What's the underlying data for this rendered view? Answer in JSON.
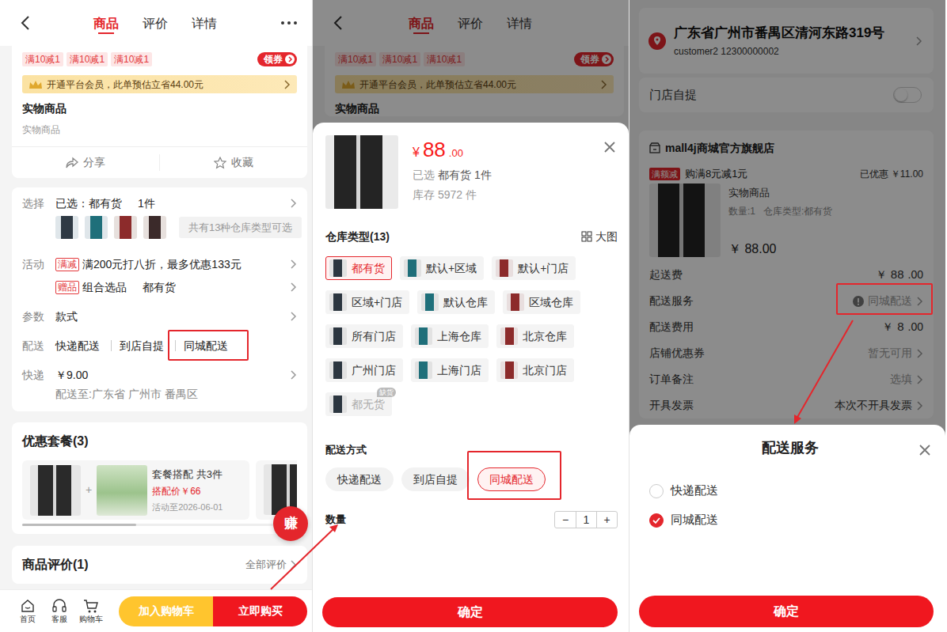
{
  "product_page": {
    "tabs": [
      {
        "label": "商品",
        "selected": true
      },
      {
        "label": "评价",
        "selected": false
      },
      {
        "label": "详情",
        "selected": false
      }
    ],
    "coupons": [
      "满10减1",
      "满10减1",
      "满10减1"
    ],
    "coupon_button": "领券",
    "member_banner": "开通平台会员，此单预估立省44.00元",
    "title": "实物商品",
    "subtitle": "实物商品",
    "actions": [
      "分享",
      "收藏"
    ],
    "select": {
      "label": "选择",
      "value": "已选：都有货",
      "quantity": "1件",
      "more": "共有13种仓库类型可选"
    },
    "activity": {
      "label": "活动",
      "items": [
        {
          "tag": "满减",
          "text": "满200元打八折，最多优惠133元"
        },
        {
          "tag": "赠品",
          "text": "组合选品",
          "extra": "都有货"
        }
      ]
    },
    "params": {
      "label": "参数",
      "value": "款式"
    },
    "delivery": {
      "label": "配送",
      "options": [
        {
          "label": "快递配送",
          "highlighted": false
        },
        {
          "label": "到店自提",
          "highlighted": false
        },
        {
          "label": "同城配送",
          "highlighted": true
        }
      ]
    },
    "express": {
      "label": "快递",
      "price": "￥9.00",
      "destination": "配送至:广东省 广州市 番禺区"
    },
    "packages": {
      "title": "优惠套餐(3)",
      "items": [
        {
          "name": "套餐搭配 共3件",
          "price": "搭配价￥66",
          "deadline": "活动至2026-06-01"
        }
      ],
      "scroll_level": 0.4
    },
    "earn_button": "赚",
    "reviews": {
      "title": "商品评价(1)",
      "more": "全部评价"
    },
    "bottom_nav": [
      "首页",
      "客服",
      "购物车"
    ],
    "add_to_cart": "加入购物车",
    "buy_now": "立即购买"
  },
  "sku_page": {
    "background": {
      "tabs": [
        {
          "label": "商品",
          "selected": true
        },
        {
          "label": "评价",
          "selected": false
        },
        {
          "label": "详情",
          "selected": false
        }
      ],
      "coupons": [
        "满10减1",
        "满10减1",
        "满10减1"
      ],
      "coupon_button": "领券",
      "member_banner": "开通平台会员，此单预估立省44.00元",
      "title": "实物商品"
    },
    "sheet": {
      "price": {
        "currency": "¥",
        "integer": "88",
        "decimal": ".00"
      },
      "selected_label": "已选",
      "selected_value": "都有货 1件",
      "stock": "库存 5972 件",
      "warehouse_title": "仓库类型(13)",
      "big_image": "大图",
      "warehouses": [
        {
          "label": "都有货",
          "selected": true,
          "disabled": false
        },
        {
          "label": "默认+区域",
          "selected": false,
          "disabled": false
        },
        {
          "label": "默认+门店",
          "selected": false,
          "disabled": false
        },
        {
          "label": "区域+门店",
          "selected": false,
          "disabled": false
        },
        {
          "label": "默认仓库",
          "selected": false,
          "disabled": false
        },
        {
          "label": "区域仓库",
          "selected": false,
          "disabled": false
        },
        {
          "label": "所有门店",
          "selected": false,
          "disabled": false
        },
        {
          "label": "上海仓库",
          "selected": false,
          "disabled": false
        },
        {
          "label": "北京仓库",
          "selected": false,
          "disabled": false
        },
        {
          "label": "广州门店",
          "selected": false,
          "disabled": false
        },
        {
          "label": "上海门店",
          "selected": false,
          "disabled": false
        },
        {
          "label": "北京门店",
          "selected": false,
          "disabled": false
        },
        {
          "label": "都无货",
          "selected": false,
          "disabled": true,
          "badge": "缺货"
        }
      ],
      "delivery_title": "配送方式",
      "delivery_options": [
        {
          "label": "快递配送",
          "selected": false,
          "highlighted": false
        },
        {
          "label": "到店自提",
          "selected": false,
          "highlighted": false
        },
        {
          "label": "同城配送",
          "selected": true,
          "highlighted": true
        }
      ],
      "quantity_label": "数量",
      "minus": "−",
      "quantity": "1",
      "plus": "+",
      "confirm": "确定"
    }
  },
  "checkout": {
    "address": {
      "text": "广东省广州市番禺区清河东路319号",
      "contact": "customer2 12300000002"
    },
    "pickup": {
      "label": "门店自提",
      "on": false
    },
    "store": {
      "name": "mall4j商城官方旗舰店",
      "promo_tag": "满额减",
      "promo_text": "购满8元减1元",
      "discount": "已优惠 ￥11.00",
      "item": {
        "name": "实物商品",
        "quantity": "数量:1",
        "warehouse": "仓库类型:都有货",
        "price": "￥ 88.00"
      }
    },
    "rows": [
      {
        "label": "起送费",
        "kind": "price",
        "currency": "￥",
        "integer": "88",
        "decimal": ".00"
      },
      {
        "label": "配送服务",
        "kind": "service",
        "value": "同城配送",
        "highlighted": true
      },
      {
        "label": "配送费用",
        "kind": "price",
        "currency": "￥",
        "integer": "8",
        "decimal": ".00"
      },
      {
        "label": "店铺优惠券",
        "kind": "link",
        "value": "暂无可用"
      },
      {
        "label": "订单备注",
        "kind": "link",
        "value": "选填"
      },
      {
        "label": "开具发票",
        "kind": "dark",
        "value": "本次不开具发票"
      }
    ],
    "sheet": {
      "title": "配送服务",
      "options": [
        {
          "label": "快递配送",
          "selected": false
        },
        {
          "label": "同城配送",
          "selected": true
        }
      ],
      "confirm": "确定"
    }
  }
}
